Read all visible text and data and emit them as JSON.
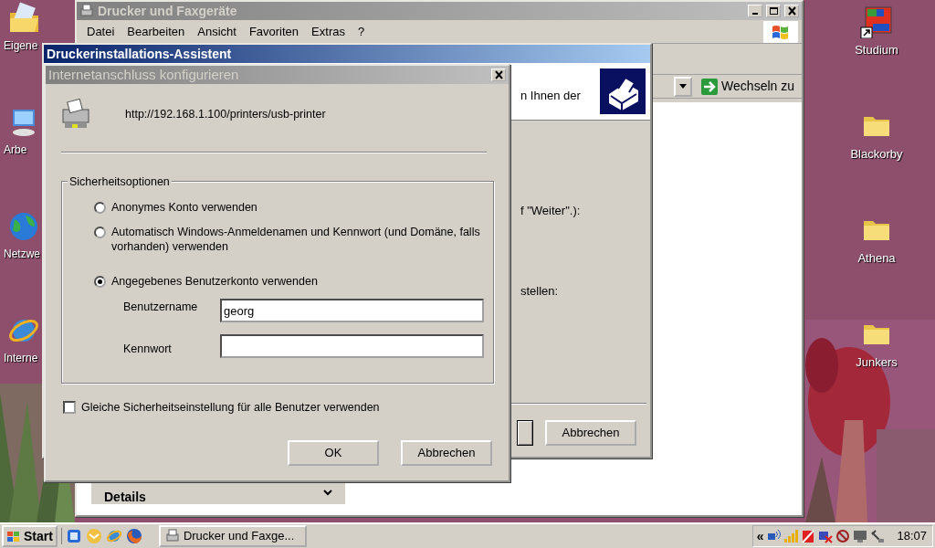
{
  "desktop": {
    "icons_left": [
      {
        "label": "Eigene",
        "kind": "docfolder"
      },
      {
        "label": "Arbe",
        "kind": "computer"
      },
      {
        "label": "Netzwe",
        "kind": "globe"
      },
      {
        "label": "Interne",
        "kind": "browser"
      }
    ],
    "icons_right": [
      {
        "label": "Studium",
        "kind": "shortcut"
      },
      {
        "label": "Blackorby",
        "kind": "folder"
      },
      {
        "label": "Athena",
        "kind": "folder"
      },
      {
        "label": "Junkers",
        "kind": "folder"
      }
    ]
  },
  "explorer": {
    "title": "Drucker und Faxgeräte",
    "menu": [
      "Datei",
      "Bearbeiten",
      "Ansicht",
      "Favoriten",
      "Extras",
      "?"
    ],
    "go_button": "Wechseln zu",
    "panel_title": "Details"
  },
  "wizard": {
    "title": "Druckerinstallations-Assistent",
    "header_text": "n Ihnen der",
    "body_texts": [
      "f \"Weiter\".):",
      "stellen:"
    ],
    "cancel_button": "Abbrechen"
  },
  "dialog": {
    "title": "Internetanschluss konfigurieren",
    "url": "http://192.168.1.100/printers/usb-printer",
    "group": {
      "title": "Sicherheitsoptionen",
      "options": [
        {
          "label": "Anonymes Konto verwenden",
          "selected": false
        },
        {
          "label": "Automatisch Windows-Anmeldenamen und Kennwort (und Domäne, falls vorhanden) verwenden",
          "selected": false
        },
        {
          "label": "Angegebenes Benutzerkonto verwenden",
          "selected": true
        }
      ],
      "fields": [
        {
          "label": "Benutzername",
          "value": "georg"
        },
        {
          "label": "Kennwort"
        }
      ]
    },
    "checkbox": {
      "label": "Gleiche Sicherheitseinstellung für alle Benutzer verwenden",
      "checked": false
    },
    "buttons": [
      "OK",
      "Abbrechen"
    ]
  },
  "taskbar": {
    "start": "Start",
    "tasks": [
      {
        "label": "Drucker und Faxge...",
        "selected": false
      }
    ],
    "tray_toggle": "«",
    "clock": "18:07"
  }
}
